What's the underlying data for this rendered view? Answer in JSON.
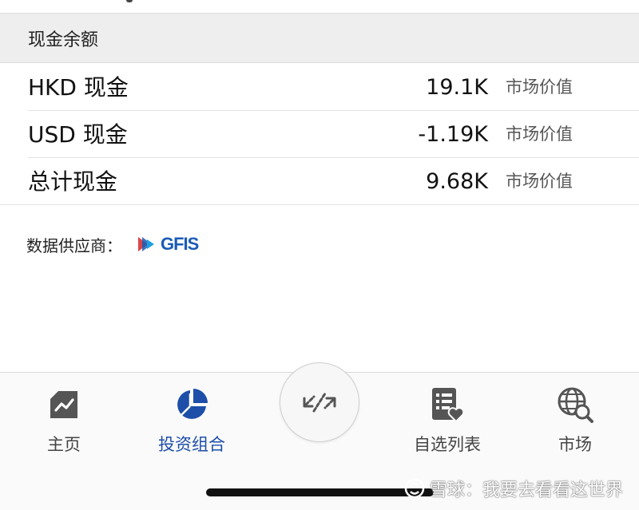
{
  "section": {
    "title": "现金余额"
  },
  "rows": [
    {
      "label": "HKD 现金",
      "value": "19.1K",
      "unit": "市场价值"
    },
    {
      "label": "USD 现金",
      "value": "-1.19K",
      "unit": "市场价值"
    },
    {
      "label": "总计现金",
      "value": "9.68K",
      "unit": "市场价值"
    }
  ],
  "provider": {
    "label": "数据供应商：",
    "logo_text": "GFIS"
  },
  "tabs": [
    {
      "label": "主页",
      "icon": "chart-trend-icon"
    },
    {
      "label": "投资组合",
      "icon": "pie-chart-icon",
      "active": true
    },
    {
      "label": "",
      "icon": "expand-arrows-icon"
    },
    {
      "label": "自选列表",
      "icon": "watchlist-heart-icon"
    },
    {
      "label": "市场",
      "icon": "globe-search-icon"
    }
  ],
  "watermark": {
    "text": "雪球：我要去看看这世界"
  },
  "colors": {
    "accent": "#1d4ea8",
    "header_bg": "#eeeeee",
    "icon_gray": "#555555"
  }
}
